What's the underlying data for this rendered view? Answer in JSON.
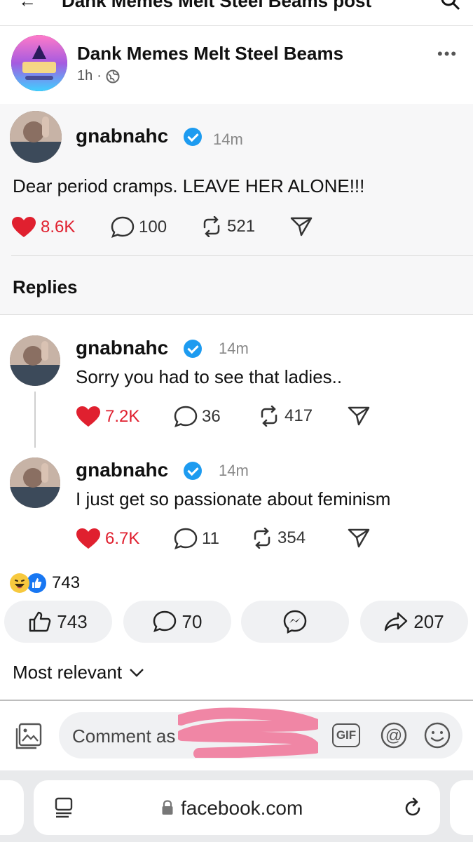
{
  "top_header": {
    "title": "Dank Memes Melt Steel Beams post"
  },
  "post": {
    "page_name": "Dank Memes Melt Steel Beams",
    "time": "1h",
    "separator": "·",
    "privacy_icon": "globe-icon",
    "more_icon": "more-dots-icon",
    "more_label": "•••"
  },
  "embedded": {
    "main": {
      "username": "gnabnahc",
      "time": "14m",
      "text": "Dear period cramps. LEAVE HER ALONE!!!",
      "likes": "8.6K",
      "comments": "100",
      "reposts": "521"
    },
    "replies_label": "Replies",
    "replies": [
      {
        "username": "gnabnahc",
        "time": "14m",
        "text": "Sorry you had to see that ladies..",
        "likes": "7.2K",
        "comments": "36",
        "reposts": "417"
      },
      {
        "username": "gnabnahc",
        "time": "14m",
        "text": "I just get so passionate about feminism",
        "likes": "6.7K",
        "comments": "11",
        "reposts": "354"
      }
    ]
  },
  "reactions": {
    "count": "743",
    "icons": [
      "haha-emoji-icon",
      "like-badge-icon"
    ]
  },
  "actions": {
    "like": "743",
    "comment": "70",
    "share": "207"
  },
  "sort": {
    "label": "Most relevant"
  },
  "composer": {
    "placeholder": "Comment as",
    "gif_label": "GIF",
    "at_label": "@"
  },
  "browser": {
    "url": "facebook.com"
  },
  "colors": {
    "like_red": "#e0202f",
    "fb_blue": "#1877f2",
    "verified_blue": "#1d9bf0",
    "redaction_pink": "#ef7fa0"
  }
}
